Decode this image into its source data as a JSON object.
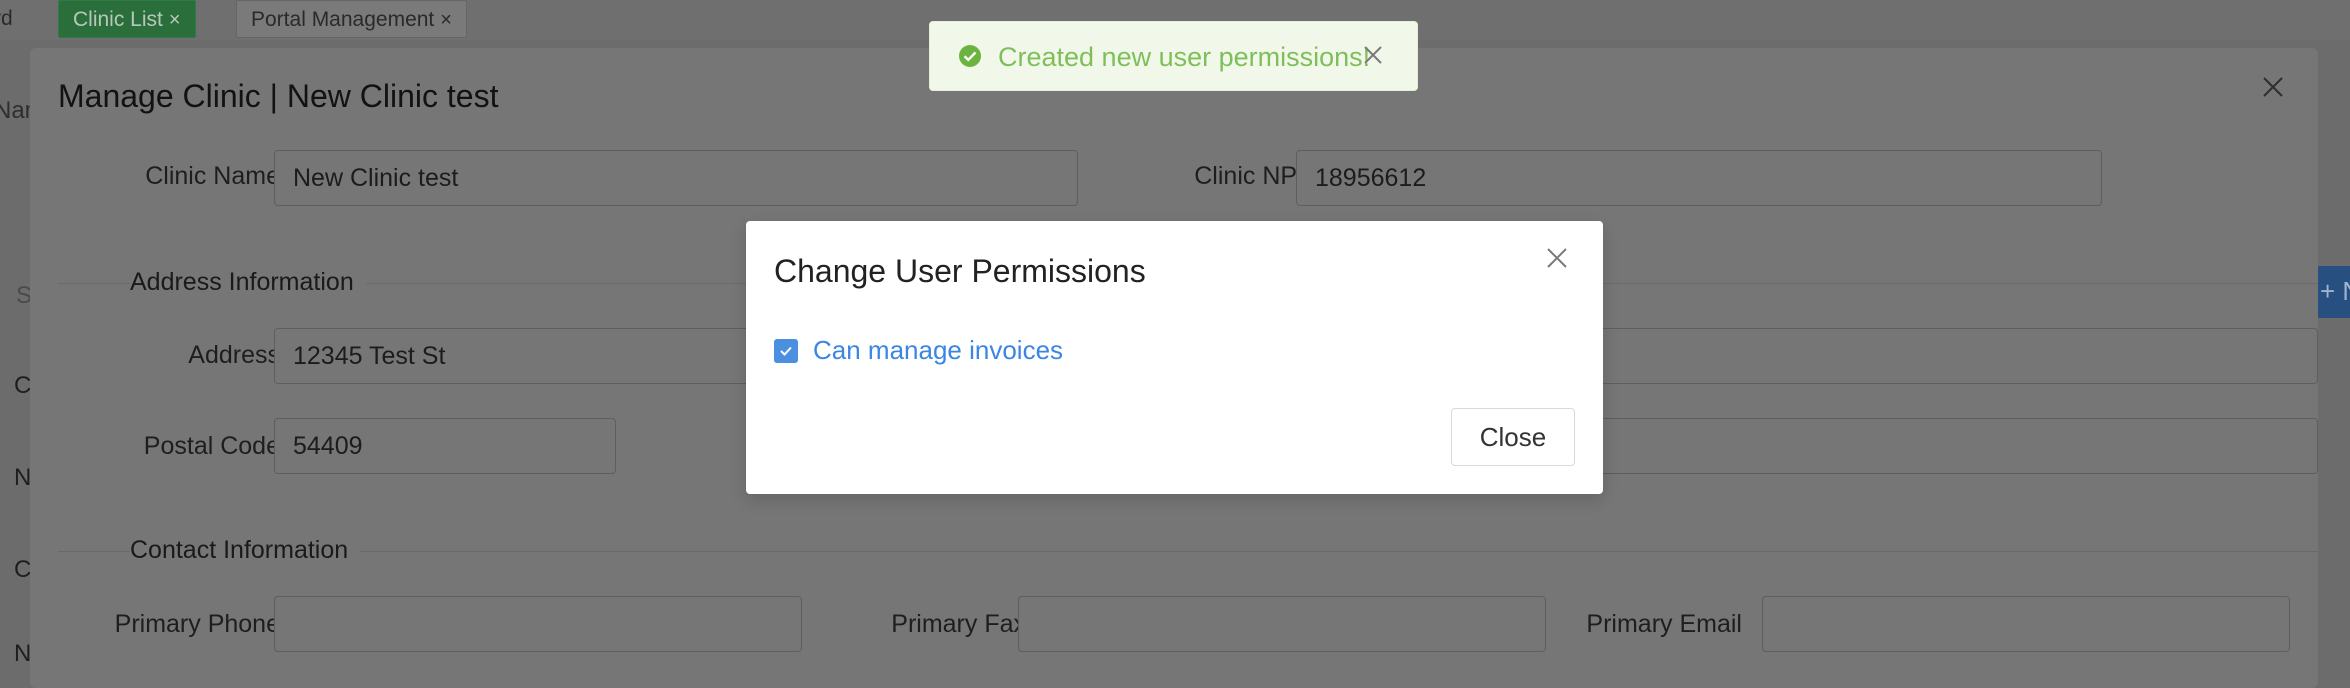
{
  "tabs": [
    {
      "label": "rd"
    },
    {
      "label": "Clinic List",
      "close": "×"
    },
    {
      "label": "Portal Management",
      "close": "×"
    }
  ],
  "background_edge_text": {
    "nam": "Nam",
    "s": "S",
    "c1": "C",
    "n": "N",
    "c2": "C",
    "n2": "N",
    "plus": "+ N"
  },
  "outer_modal": {
    "title": "Manage Clinic | New Clinic test",
    "clinic_name_label": "Clinic Name",
    "clinic_name_value": "New Clinic test",
    "clinic_npi_label": "Clinic NPI",
    "clinic_npi_value": "18956612",
    "address_section": "Address Information",
    "address_label": "Address",
    "address_value": "12345 Test St",
    "postal_label": "Postal Code",
    "postal_value": "54409",
    "contact_section": "Contact Information",
    "primary_phone_label": "Primary Phone",
    "primary_phone_value": "",
    "primary_fax_label": "Primary Fax",
    "primary_fax_value": "",
    "primary_email_label": "Primary Email",
    "primary_email_value": ""
  },
  "permissions_modal": {
    "title": "Change User Permissions",
    "permission_label": "Can manage invoices",
    "permission_checked": true,
    "close_button": "Close"
  },
  "toast": {
    "message": "Created new user permissions!",
    "type": "success"
  },
  "colors": {
    "accent_blue": "#4a8fe0",
    "success_green": "#7fbf5a",
    "active_tab": "#2a6e3b"
  }
}
